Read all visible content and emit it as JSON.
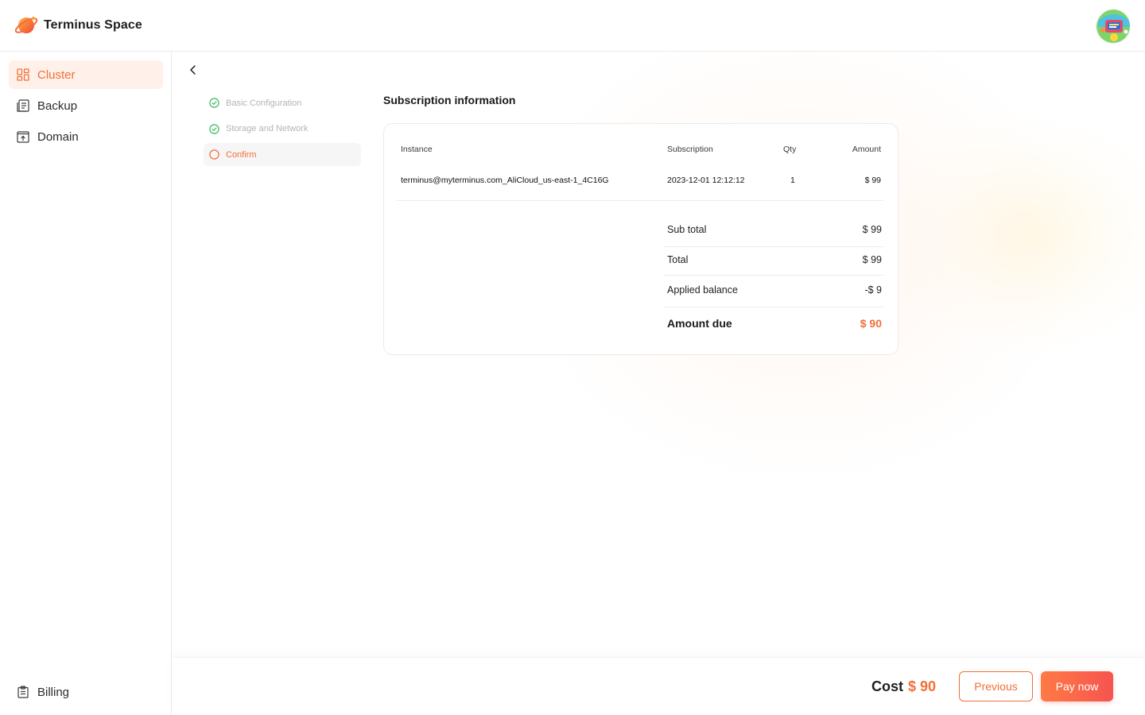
{
  "header": {
    "brand_name": "Terminus Space"
  },
  "sidebar": {
    "items": [
      {
        "label": "Cluster",
        "icon": "cluster-icon",
        "active": true
      },
      {
        "label": "Backup",
        "icon": "backup-icon",
        "active": false
      },
      {
        "label": "Domain",
        "icon": "domain-icon",
        "active": false
      }
    ],
    "bottom_item": {
      "label": "Billing",
      "icon": "billing-icon"
    }
  },
  "steps": [
    {
      "label": "Basic Configuration",
      "status": "done"
    },
    {
      "label": "Storage and Network",
      "status": "done"
    },
    {
      "label": "Confirm",
      "status": "current"
    }
  ],
  "subscription": {
    "title": "Subscription information",
    "columns": [
      "Instance",
      "Subscription",
      "Qty",
      "Amount"
    ],
    "rows": [
      {
        "instance": "terminus@myterminus.com_AliCloud_us-east-1_4C16G",
        "subscription": "2023-12-01 12:12:12",
        "qty": "1",
        "amount": "$ 99"
      }
    ],
    "summary": [
      {
        "label": "Sub total",
        "value": "$ 99"
      },
      {
        "label": "Total",
        "value": "$ 99"
      },
      {
        "label": "Applied balance",
        "value": "-$ 9"
      }
    ],
    "amount_due_label": "Amount due",
    "amount_due_value": "$ 90"
  },
  "footer": {
    "cost_label": "Cost",
    "cost_value": "$ 90",
    "previous_label": "Previous",
    "pay_label": "Pay now"
  },
  "colors": {
    "accent": "#f26f37",
    "success": "#3cb85c",
    "active_bg": "#fff1ea"
  }
}
